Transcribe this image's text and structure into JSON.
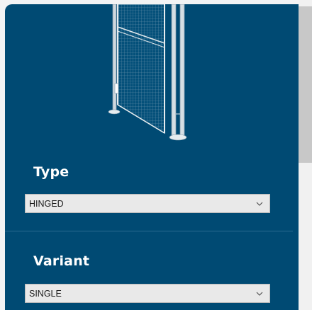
{
  "type_section": {
    "label": "Type",
    "selected": "HINGED"
  },
  "variant_section": {
    "label": "Variant",
    "selected": "SINGLE"
  },
  "colors": {
    "panel_bg": "#004a73",
    "label_text": "#ffffff",
    "select_bg": "#e9e9e9"
  },
  "icons": {
    "dropdown": "chevron-down-icon",
    "product": "hinged-gate-panel-image"
  }
}
